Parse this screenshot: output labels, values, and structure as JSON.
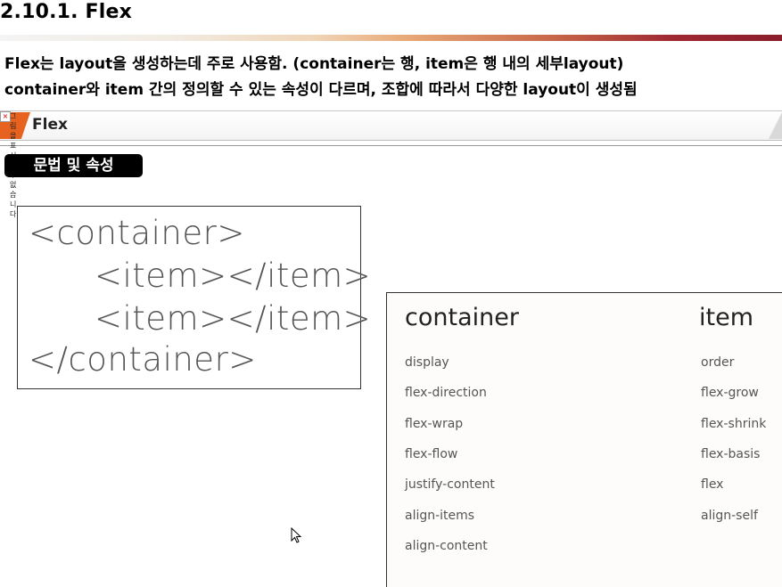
{
  "heading": "2.10.1. Flex",
  "description": {
    "line1": "Flex는 layout을 생성하는데 주로 사용함. (container는 행, item은 행 내의 세부layout)",
    "line2": "container와 item 간의 정의할 수 있는 속성이 다르며, 조합에 따라서 다양한 layout이 생성됨"
  },
  "slide": {
    "title": "Flex",
    "broken_image_alt": "그림을 표시할 수 없습니다.",
    "section_badge": "문법 및 속성",
    "code_lines": [
      "<container>",
      "<item></item>",
      "<item></item>",
      "</container>"
    ],
    "container_header": "container",
    "item_header": "item",
    "container_props": [
      "display",
      "flex-direction",
      "flex-wrap",
      "flex-flow",
      "justify-content",
      "align-items",
      "align-content"
    ],
    "item_props": [
      "order",
      "flex-grow",
      "flex-shrink",
      "flex-basis",
      "flex",
      "align-self"
    ]
  },
  "colors": {
    "accent_orange": "#e8621f",
    "rule_dark_red": "#8a1d2a",
    "badge_bg": "#000000"
  }
}
